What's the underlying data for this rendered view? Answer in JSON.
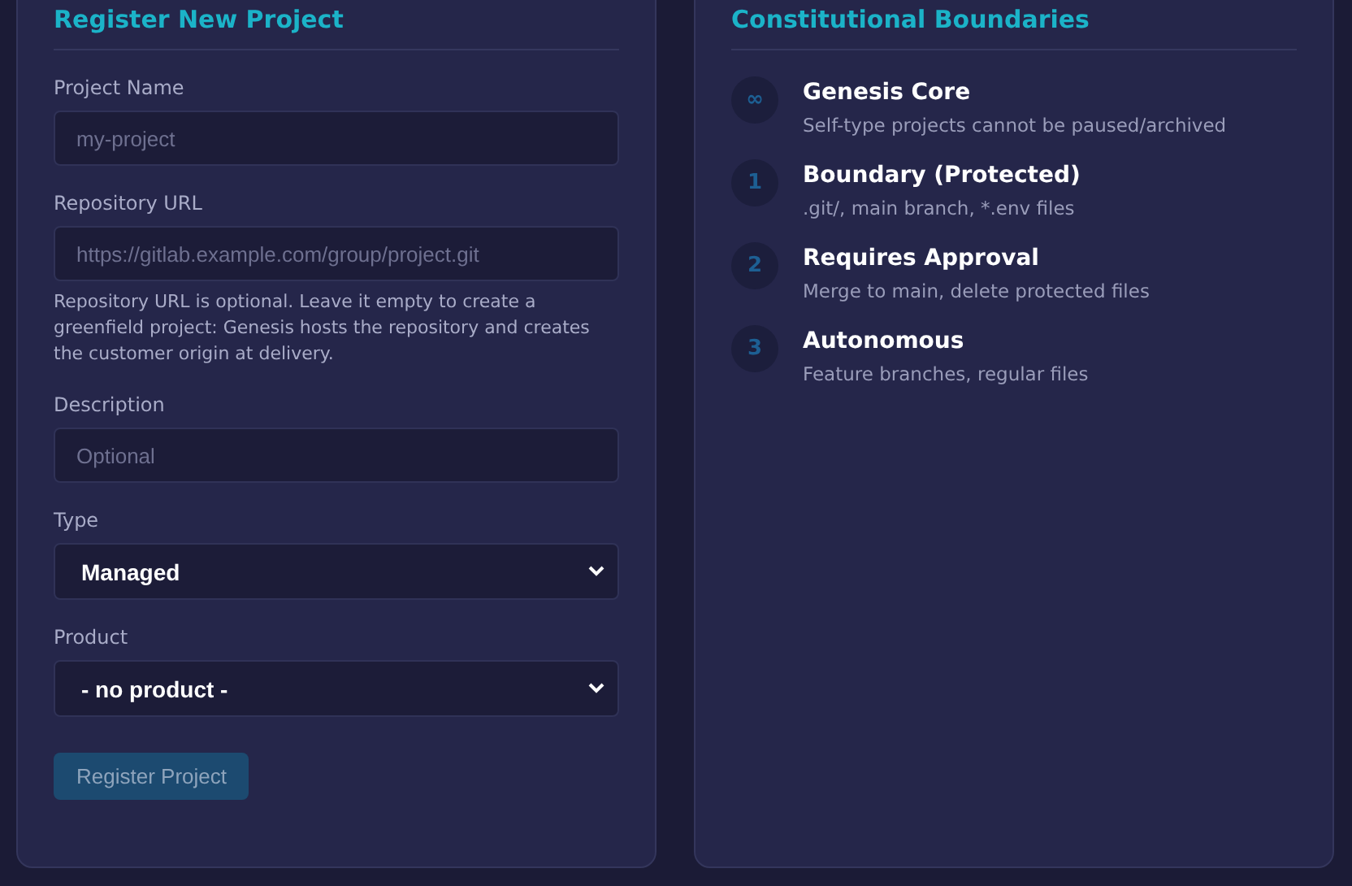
{
  "register_form": {
    "title": "Register New Project",
    "fields": [
      {
        "kind": "input",
        "label": "Project Name",
        "placeholder": "my-project"
      },
      {
        "kind": "input",
        "label": "Repository URL",
        "placeholder": "https://gitlab.example.com/group/project.git",
        "help": "Repository URL is optional. Leave it empty to create a greenfield project: Genesis hosts the repository and creates the customer origin at delivery."
      },
      {
        "kind": "input",
        "label": "Description",
        "placeholder": "Optional"
      },
      {
        "kind": "select",
        "label": "Type",
        "value": "Managed"
      },
      {
        "kind": "select",
        "label": "Product",
        "value": "- no product -"
      }
    ],
    "submit": {
      "label": "Register Project",
      "disabled": true
    }
  },
  "boundaries": {
    "title": "Constitutional Boundaries",
    "items": [
      {
        "marker": "∞",
        "title": "Genesis Core",
        "description": "Self-type projects cannot be paused/archived"
      },
      {
        "marker": "1",
        "title": "Boundary (Protected)",
        "description": ".git/, main branch, *.env files"
      },
      {
        "marker": "2",
        "title": "Requires Approval",
        "description": "Merge to main, delete protected files"
      },
      {
        "marker": "3",
        "title": "Autonomous",
        "description": "Feature branches, regular files"
      }
    ]
  }
}
